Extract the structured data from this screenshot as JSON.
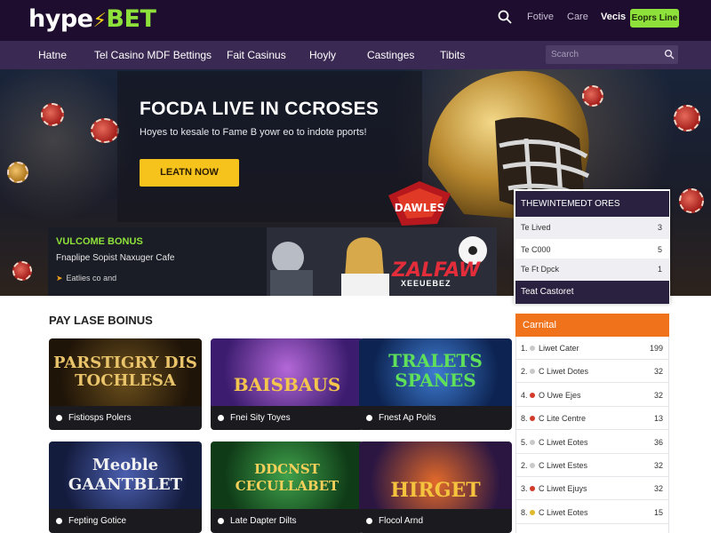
{
  "header": {
    "logo": {
      "part1": "hype",
      "part2": "BET"
    },
    "links": [
      "Fotive",
      "Care",
      "Vecis"
    ],
    "signup_label": "Eoprs Line"
  },
  "nav": {
    "items": [
      "Hatne",
      "Tel Casino MDF Bettings",
      "Fait Casinus",
      "Hoyly",
      "Castinges",
      "Tibits"
    ],
    "search_placeholder": "Scarch"
  },
  "hero": {
    "title": "FOCDA LIVE IN CCROSES",
    "subtitle": "Hoyes to kesale to Fame B yowr eo to indote pports!",
    "cta_label": "LEATN NOW",
    "badge": "DAWLES"
  },
  "welcome": {
    "title": "VULCOME BONUS",
    "subtitle": "Fnaplipe Sopist Naxuger Cafe",
    "link": "Eatlies co and",
    "promo_logo": "ZALFAW",
    "promo_sub": "XEEUEBEZ"
  },
  "live_events": {
    "header": "THEWINTEMEDT ORES",
    "rows": [
      {
        "label": "Te Lived",
        "count": "3"
      },
      {
        "label": "Te C000",
        "count": "5"
      },
      {
        "label": "Te Ft Dpck",
        "count": "1"
      }
    ],
    "footer": "Teat Castoret"
  },
  "games_section": {
    "title": "PAY LASE BOINUS",
    "games": [
      {
        "art": "PARSTIGRY DIS TOCHLESA",
        "name": "Fistiosps Polers"
      },
      {
        "art": "BAISBAUS",
        "name": "Fnei Sity Toyes"
      },
      {
        "art": "TRALETS SPANES",
        "name": "Fnest Ap Poits"
      },
      {
        "art": "Meoble GAANTBLET",
        "name": "Fepting Gotice"
      },
      {
        "art": "DDCNST CECULLABET",
        "name": "Late Dapter Dilts"
      },
      {
        "art": "HIRGET",
        "name": "Flocol Arnd"
      }
    ]
  },
  "leaderboard": {
    "header": "Carnital",
    "rows": [
      {
        "rank": "1.",
        "label": "Liwet Cater",
        "value": "199",
        "color": "#c9c9c9"
      },
      {
        "rank": "2.",
        "label": "C Liwet Dotes",
        "value": "32",
        "color": "#c9c9c9"
      },
      {
        "rank": "4.",
        "label": "O Uwe Ejes",
        "value": "32",
        "color": "#d23a2a"
      },
      {
        "rank": "8.",
        "label": "C Lite Centre",
        "value": "13",
        "color": "#d23a2a"
      },
      {
        "rank": "5.",
        "label": "C Liwet Eotes",
        "value": "36",
        "color": "#c9c9c9"
      },
      {
        "rank": "2.",
        "label": "C Liwet Estes",
        "value": "32",
        "color": "#c9c9c9"
      },
      {
        "rank": "3.",
        "label": "C Liwet Ejuys",
        "value": "32",
        "color": "#d23a2a"
      },
      {
        "rank": "8.",
        "label": "C Liwet Eotes",
        "value": "15",
        "color": "#e0b92a"
      }
    ]
  },
  "colors": {
    "brand_green": "#8ee13a",
    "brand_yellow": "#f7d117",
    "header_bg": "#1e0d2e",
    "nav_bg": "#3a2952",
    "cta": "#f6c21c",
    "leaderboard_accent": "#f0731c"
  }
}
